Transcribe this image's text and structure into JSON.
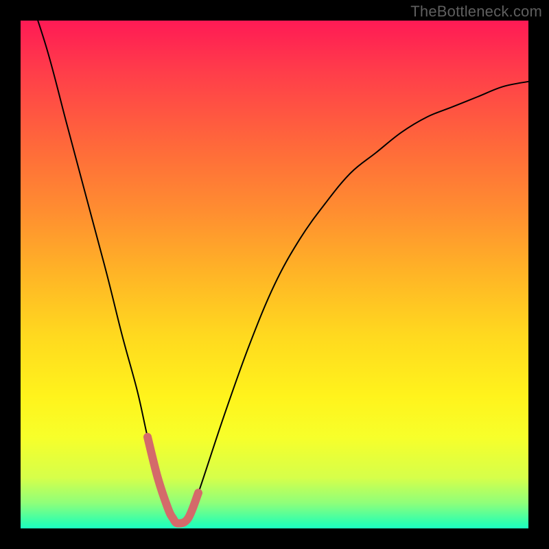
{
  "watermark": "TheBottleneck.com",
  "chart_data": {
    "type": "line",
    "title": "",
    "xlabel": "",
    "ylabel": "",
    "xlim": [
      0,
      100
    ],
    "ylim": [
      0,
      100
    ],
    "grid": false,
    "series": [
      {
        "name": "bottleneck-curve",
        "color": "#000000",
        "stroke_width": 2,
        "x": [
          0,
          5,
          9,
          13,
          17,
          20,
          23,
          25,
          27,
          29,
          31,
          33,
          35,
          40,
          45,
          50,
          55,
          60,
          65,
          70,
          75,
          80,
          85,
          90,
          95,
          100
        ],
        "values": [
          110,
          95,
          80,
          65,
          50,
          38,
          27,
          18,
          10,
          4,
          1,
          2,
          7,
          22,
          36,
          48,
          57,
          64,
          70,
          74,
          78,
          81,
          83,
          85,
          87,
          88
        ]
      },
      {
        "name": "optimal-region",
        "color": "#d46a6a",
        "stroke_width": 12,
        "x": [
          25,
          27,
          29,
          30,
          31,
          33,
          35
        ],
        "values": [
          18,
          10,
          4,
          2,
          1,
          2,
          7
        ]
      }
    ]
  }
}
